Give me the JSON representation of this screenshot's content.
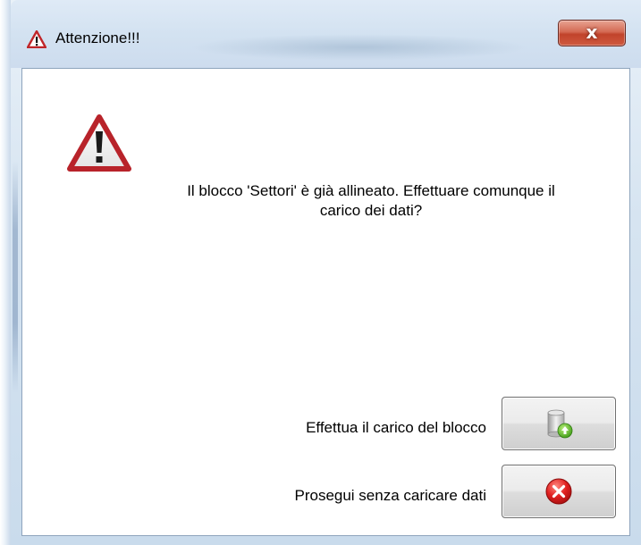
{
  "window": {
    "title": "Attenzione!!!",
    "close_label": "x"
  },
  "dialog": {
    "message": "Il blocco 'Settori' è già allineato. Effettuare comunque il carico dei dati?",
    "actions": [
      {
        "label": "Effettua il carico del blocco",
        "icon": "database-upload-icon"
      },
      {
        "label": "Prosegui senza caricare dati",
        "icon": "cancel-x-icon"
      }
    ]
  },
  "colors": {
    "warning_red": "#c0262a",
    "close_button": "#c1432b",
    "frame": "#cddcee"
  }
}
